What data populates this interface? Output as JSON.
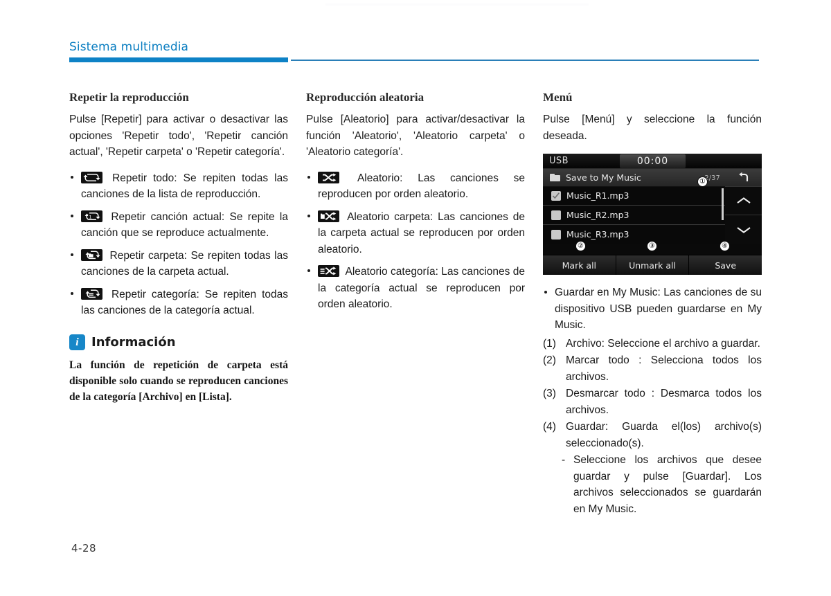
{
  "page": {
    "running_header": "Sistema multimedia",
    "folio": "4-28",
    "accent_color": "#0e82c6",
    "rule_thin_color": "#2a7fb8"
  },
  "col_repeat": {
    "title": "Repetir la reproducción",
    "intro": "Pulse [Repetir] para activar o desactivar las opciones 'Repetir todo', 'Repetir canción actual', 'Repetir carpeta' o 'Repetir categoría'.",
    "items": [
      {
        "icon": "repeat-all-icon",
        "text": "Repetir todo: Se repiten todas las canciones de la lista de reproducción."
      },
      {
        "icon": "repeat-one-icon",
        "text": "Repetir canción actual: Se repite la canción que se reproduce actualmente."
      },
      {
        "icon": "repeat-folder-icon",
        "text": "Repetir carpeta: Se repiten todas las canciones de la carpeta actual."
      },
      {
        "icon": "repeat-category-icon",
        "text": "Repetir categoría: Se repiten todas las canciones de la categoría actual."
      }
    ],
    "info": {
      "icon": "information-icon",
      "icon_glyph": "i",
      "title": "Información",
      "body": "La función de repetición de carpeta está disponible solo cuando se reproducen canciones de la categoría [Archivo] en [Lista]."
    }
  },
  "col_shuffle": {
    "title": "Reproducción aleatoria",
    "intro": "Pulse [Aleatorio] para activar/desactivar la función 'Aleatorio', 'Aleatorio carpeta' o 'Aleatorio categoría'.",
    "items": [
      {
        "icon": "shuffle-all-icon",
        "text": "Aleatorio: Las canciones se reproducen por orden aleatorio."
      },
      {
        "icon": "shuffle-folder-icon",
        "text": "Aleatorio carpeta: Las canciones de la carpeta actual se reproducen por orden aleatorio."
      },
      {
        "icon": "shuffle-category-icon",
        "text": "Aleatorio categoría: Las canciones de la categoría actual se reproducen por orden aleatorio."
      }
    ]
  },
  "col_menu": {
    "title": "Menú",
    "intro": "Pulse [Menú] y seleccione la función deseada.",
    "device": {
      "source_label": "USB",
      "clock": "00:00",
      "folder_icon": "folder-icon",
      "folder_title": "Save to My Music",
      "item_count": "2/37",
      "back_icon": "back-arrow-icon",
      "scroll_up_icon": "chevron-up-icon",
      "scroll_down_icon": "chevron-down-icon",
      "rows": [
        {
          "name": "Music_R1.mp3",
          "checked": true
        },
        {
          "name": "Music_R2.mp3",
          "checked": false
        },
        {
          "name": "Music_R3.mp3",
          "checked": false
        }
      ],
      "buttons": [
        {
          "label": "Mark all"
        },
        {
          "label": "Unmark all"
        },
        {
          "label": "Save"
        }
      ],
      "callouts": [
        "①",
        "②",
        "③",
        "④"
      ]
    },
    "bullets": [
      "Guardar en My Music: Las canciones de su dispositivo USB pueden guardarse en My Music."
    ],
    "numbered": [
      {
        "marker": "(1)",
        "text": "Archivo: Seleccione el archivo a guardar."
      },
      {
        "marker": "(2)",
        "text": "Marcar todo : Selecciona todos los archivos."
      },
      {
        "marker": "(3)",
        "text": "Desmarcar todo : Desmarca todos los archivos."
      },
      {
        "marker": "(4)",
        "text": "Guardar: Guarda el(los) archivo(s) seleccionado(s)."
      }
    ],
    "sub_note": {
      "marker": "-",
      "text": "Seleccione los archivos que desee guardar y pulse [Guardar]. Los archivos seleccionados se guardarán en My Music."
    }
  }
}
